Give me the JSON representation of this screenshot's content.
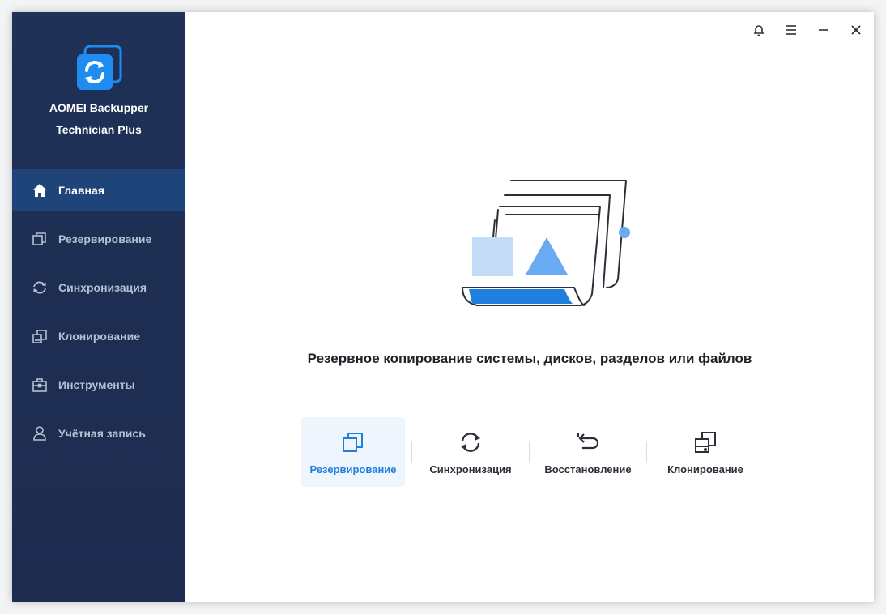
{
  "app": {
    "name": "AOMEI Backupper",
    "edition": "Technician Plus"
  },
  "sidebar": {
    "items": [
      {
        "label": "Главная",
        "icon": "home-icon",
        "active": true
      },
      {
        "label": "Резервирование",
        "icon": "backup-icon",
        "active": false
      },
      {
        "label": "Синхронизация",
        "icon": "sync-icon",
        "active": false
      },
      {
        "label": "Клонирование",
        "icon": "clone-icon",
        "active": false
      },
      {
        "label": "Инструменты",
        "icon": "tools-icon",
        "active": false
      },
      {
        "label": "Учётная запись",
        "icon": "account-icon",
        "active": false
      }
    ]
  },
  "titlebar": {
    "buttons": [
      "bell-icon",
      "menu-icon",
      "minimize-icon",
      "close-icon"
    ]
  },
  "main": {
    "headline": "Резервное копирование системы, дисков, разделов или файлов",
    "actions": [
      {
        "label": "Резервирование",
        "icon": "backup-icon",
        "hover": true
      },
      {
        "label": "Синхронизация",
        "icon": "sync-icon",
        "hover": false
      },
      {
        "label": "Восстановление",
        "icon": "restore-icon",
        "hover": false
      },
      {
        "label": "Клонирование",
        "icon": "clone-icon",
        "hover": false
      }
    ]
  },
  "colors": {
    "sidebar_bg": "#1f3157",
    "sidebar_active": "#1f4479",
    "accent": "#1f7fe0",
    "logo_blue": "#1e8cf0"
  }
}
